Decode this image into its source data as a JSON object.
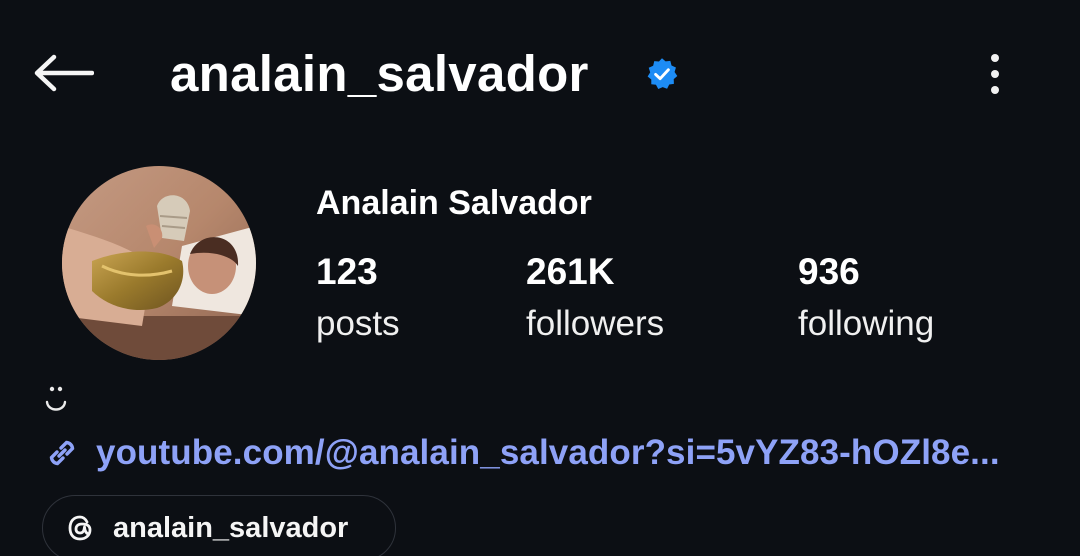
{
  "header": {
    "back_icon": "arrow-left-icon",
    "username": "analain_salvador",
    "verified_icon": "verified-badge-icon",
    "more_icon": "more-vertical-icon"
  },
  "profile": {
    "display_name": "Analain Salvador",
    "stats": [
      {
        "value": "123",
        "label": "posts"
      },
      {
        "value": "261K",
        "label": "followers"
      },
      {
        "value": "936",
        "label": "following"
      }
    ],
    "bio_icon": "smile-face-icon",
    "link": {
      "icon": "link-icon",
      "text": "youtube.com/@analain_salvador?si=5vYZ83-hOZl8e..."
    },
    "threads": {
      "icon": "threads-icon",
      "label": "analain_salvador"
    }
  },
  "colors": {
    "background": "#0c0f14",
    "link": "#8ea2f7",
    "verified": "#1d8cf5"
  }
}
